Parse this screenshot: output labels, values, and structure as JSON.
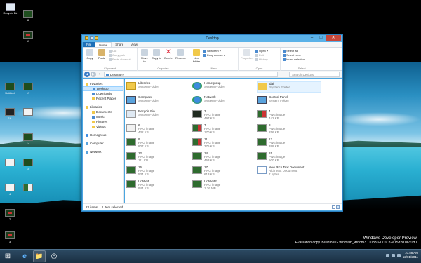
{
  "desktop": {
    "icons": [
      {
        "label": "Recycle Bin",
        "thumb": "white"
      },
      {
        "label": "8",
        "thumb": "green"
      },
      {
        "label": "11",
        "thumb": "red"
      },
      {
        "label": "Untitled",
        "thumb": "green"
      },
      {
        "label": "17",
        "thumb": "green"
      },
      {
        "label": "16",
        "thumb": "dark"
      },
      {
        "label": "",
        "thumb": "white"
      },
      {
        "label": "14",
        "thumb": "green"
      },
      {
        "label": "",
        "thumb": "white"
      },
      {
        "label": "10",
        "thumb": "green"
      },
      {
        "label": "4",
        "thumb": "white"
      },
      {
        "label": "",
        "thumb": "mix"
      },
      {
        "label": "7",
        "thumb": "red"
      },
      {
        "label": "3",
        "thumb": "red"
      }
    ]
  },
  "watermark": {
    "title": "Windows Developer Preview",
    "build": "Evaluation copy. Build 8102.winmain_win8m3.110830-1739.b2e15d2d1a7f1d0"
  },
  "taskbar": {
    "start_icon": "⊞",
    "ie_icon": "e",
    "explorer_icon": "📁",
    "fourth_icon": "◎",
    "clock_time": "10:58 AM",
    "clock_date": "12/01/2011"
  },
  "window": {
    "title": "Desktop",
    "tabs": [
      "File",
      "Home",
      "Share",
      "View"
    ],
    "active_tab": "Home",
    "ribbon": {
      "clipboard": {
        "label": "Clipboard",
        "copy": "Copy",
        "paste": "Paste",
        "cut": "Cut",
        "copy_path": "Copy path",
        "paste_shortcut": "Paste shortcut"
      },
      "organize": {
        "label": "Organize",
        "move_to": "Move to",
        "copy_to": "Copy to",
        "delete": "Delete",
        "rename": "Rename"
      },
      "new": {
        "label": "New",
        "new_folder": "New folder",
        "new_item": "New item ▾",
        "easy_access": "Easy access ▾"
      },
      "open": {
        "label": "Open",
        "properties": "Properties",
        "open": "Open ▾",
        "edit": "Edit",
        "history": "History"
      },
      "select": {
        "label": "Select",
        "select_all": "Select all",
        "select_none": "Select none",
        "invert": "Invert selection"
      }
    },
    "address": {
      "path": "Desktop ▸",
      "search_placeholder": "Search Desktop"
    },
    "nav": {
      "favorites": "Favorites",
      "desktop": "Desktop",
      "downloads": "Downloads",
      "recent": "Recent Places",
      "libraries": "Libraries",
      "documents": "Documents",
      "music": "Music",
      "pictures": "Pictures",
      "videos": "Videos",
      "homegroup": "Homegroup",
      "computer": "Computer",
      "network": "Network"
    },
    "files": [
      {
        "name": "Libraries",
        "type": "System Folder",
        "size": "",
        "thumb": "folder"
      },
      {
        "name": "Homegroup",
        "type": "System Folder",
        "size": "",
        "thumb": "globe"
      },
      {
        "name": "dai",
        "type": "System Folder",
        "size": "",
        "thumb": "folder"
      },
      {
        "name": "Computer",
        "type": "System Folder",
        "size": "",
        "thumb": "monitor"
      },
      {
        "name": "Network",
        "type": "System Folder",
        "size": "",
        "thumb": "globe"
      },
      {
        "name": "Control Panel",
        "type": "System Folder",
        "size": "",
        "thumb": "monitor"
      },
      {
        "name": "Recycle Bin",
        "type": "System Folder",
        "size": "",
        "thumb": "recycle"
      },
      {
        "name": "3",
        "type": "PNG image",
        "size": "497 KB",
        "thumb": "dark"
      },
      {
        "name": "4",
        "type": "PNG image",
        "size": "442 KB",
        "thumb": "greenred"
      },
      {
        "name": "6",
        "type": "PNG image",
        "size": "432 KB",
        "thumb": "white"
      },
      {
        "name": "7",
        "type": "PNG image",
        "size": "170 KB",
        "thumb": "greenred"
      },
      {
        "name": "8",
        "type": "PNG image",
        "size": "256 KB",
        "thumb": "green"
      },
      {
        "name": "9",
        "type": "PNG image",
        "size": "807 KB",
        "thumb": "green"
      },
      {
        "name": "11",
        "type": "PNG image",
        "size": "376 KB",
        "thumb": "greenred"
      },
      {
        "name": "13",
        "type": "PNG image",
        "size": "398 KB",
        "thumb": "green"
      },
      {
        "name": "12",
        "type": "PNG image",
        "size": "111 KB",
        "thumb": "green"
      },
      {
        "name": "14",
        "type": "PNG image",
        "size": "463 KB",
        "thumb": "green"
      },
      {
        "name": "15",
        "type": "PNG image",
        "size": "600 KB",
        "thumb": "green"
      },
      {
        "name": "16",
        "type": "PNG image",
        "size": "534 KB",
        "thumb": "green"
      },
      {
        "name": "17",
        "type": "PNG image",
        "size": "613 KB",
        "thumb": "green"
      },
      {
        "name": "New Rich Text Document",
        "type": "Rich Text Document",
        "size": "7 bytes",
        "thumb": "doc"
      },
      {
        "name": "Untitled",
        "type": "PNG image",
        "size": "944 KB",
        "thumb": "green"
      },
      {
        "name": "Untitled2",
        "type": "PNG image",
        "size": "1.36 MB",
        "thumb": "green"
      }
    ],
    "status": {
      "count": "23 items",
      "selected": "1 item selected"
    }
  }
}
